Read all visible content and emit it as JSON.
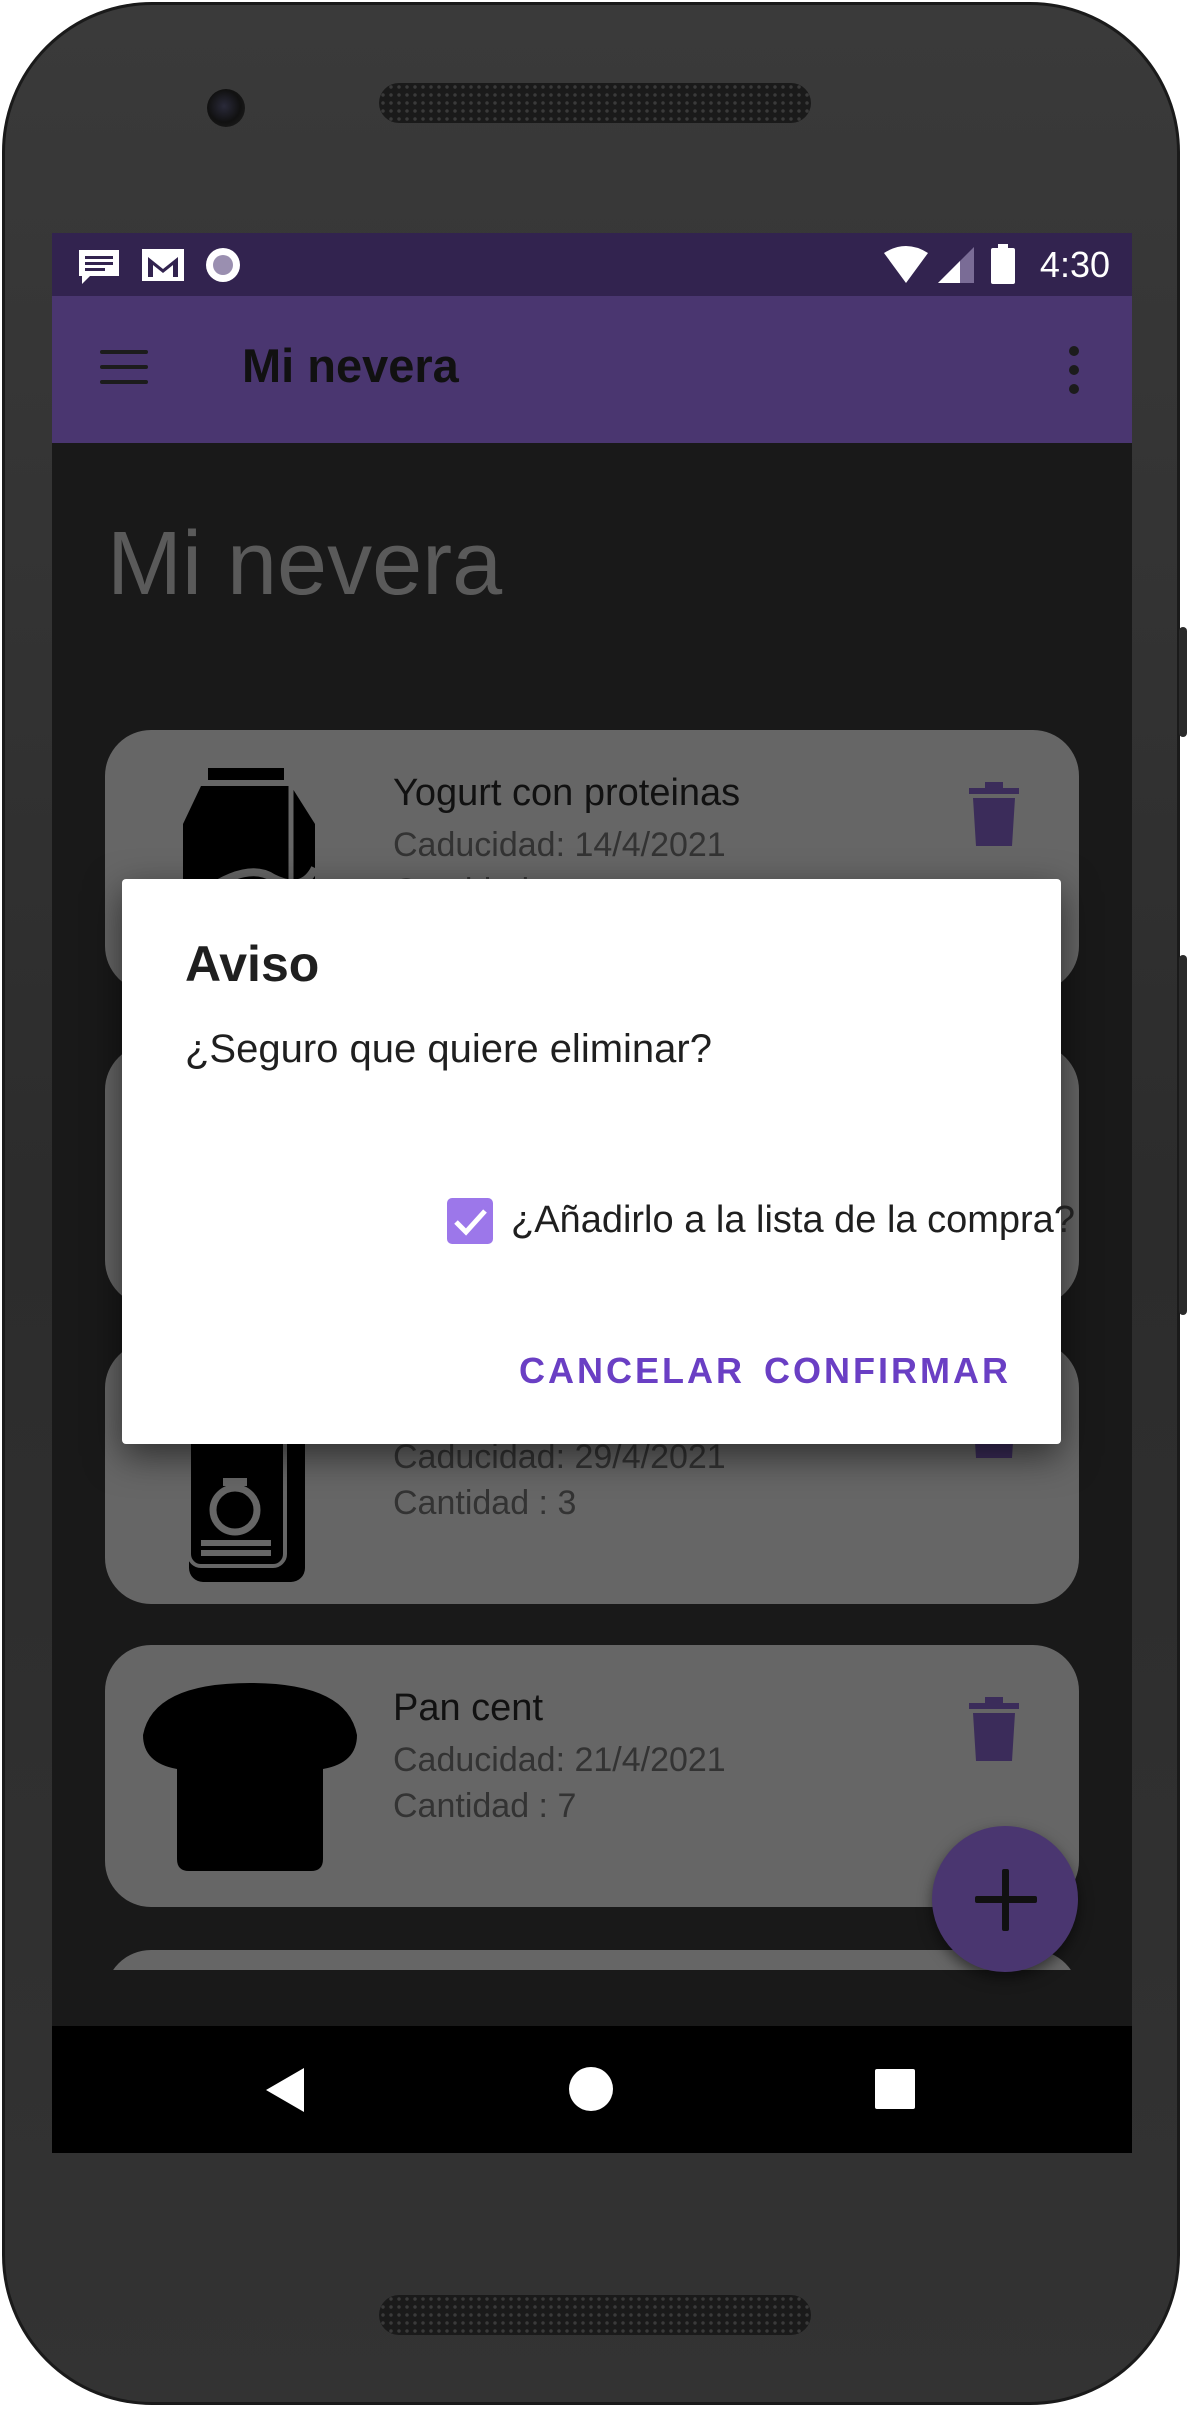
{
  "status_bar": {
    "time": "4:30",
    "notification_icons": [
      "message-icon",
      "gmail-icon",
      "record-icon"
    ],
    "system_icons": [
      "wifi-icon",
      "signal-icon",
      "battery-icon"
    ]
  },
  "app_bar": {
    "title": "Mi nevera",
    "menu_icon": "hamburger-menu-icon",
    "overflow_icon": "more-vert-icon",
    "color": "#4a3670",
    "status_color": "#32234f"
  },
  "page": {
    "heading": "Mi nevera"
  },
  "products": [
    {
      "name": "Yogurt con proteinas",
      "expiry": "Caducidad: 14/4/2021",
      "quantity": "Cantidad : ",
      "icon": "milk-carton-icon"
    },
    {
      "name": "",
      "expiry": "",
      "quantity": "",
      "icon": ""
    },
    {
      "name": "",
      "expiry": "Caducidad: 29/4/2021",
      "quantity": "Cantidad : 3",
      "icon": "can-icon"
    },
    {
      "name": "Pan cent",
      "expiry": "Caducidad: 21/4/2021",
      "quantity": "Cantidad : 7",
      "icon": "bread-icon"
    }
  ],
  "fab": {
    "icon": "add-icon"
  },
  "dialog": {
    "title": "Aviso",
    "message": "¿Seguro que quiere eliminar?",
    "checkbox_label": "¿Añadirlo a la lista de la compra?",
    "checkbox_checked": true,
    "cancel_label": "CANCELAR",
    "confirm_label": "CONFIRMAR",
    "accent": "#6a3fc4"
  },
  "nav_bar": {
    "icons": [
      "back-icon",
      "home-icon",
      "recents-icon"
    ]
  }
}
